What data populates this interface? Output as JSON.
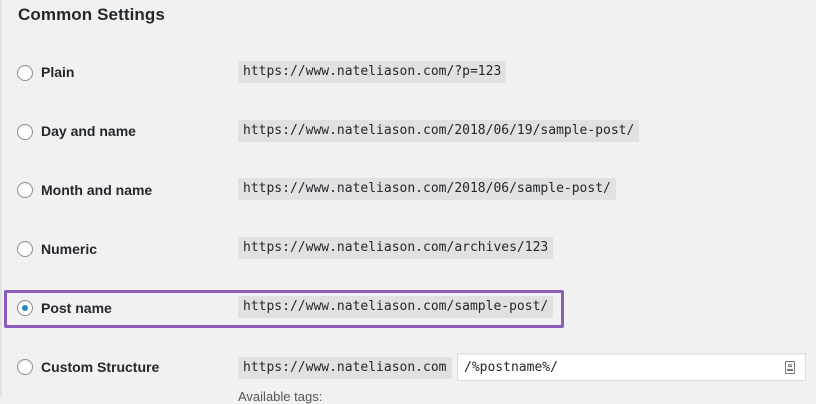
{
  "section": {
    "title": "Common Settings"
  },
  "options": [
    {
      "label": "Plain",
      "example": "https://www.nateliason.com/?p=123",
      "checked": false
    },
    {
      "label": "Day and name",
      "example": "https://www.nateliason.com/2018/06/19/sample-post/",
      "checked": false
    },
    {
      "label": "Month and name",
      "example": "https://www.nateliason.com/2018/06/sample-post/",
      "checked": false
    },
    {
      "label": "Numeric",
      "example": "https://www.nateliason.com/archives/123",
      "checked": false
    },
    {
      "label": "Post name",
      "example": "https://www.nateliason.com/sample-post/",
      "checked": true
    },
    {
      "label": "Custom Structure",
      "example": "https://www.nateliason.com",
      "checked": false
    }
  ],
  "custom_structure": {
    "value": "/%postname%/"
  },
  "available_tags_label": "Available tags:",
  "colors": {
    "highlight": "#8b5cb8",
    "radio_selected": "#1e8cbe",
    "code_bg": "#e1e1e1",
    "page_bg": "#f1f1f1"
  }
}
